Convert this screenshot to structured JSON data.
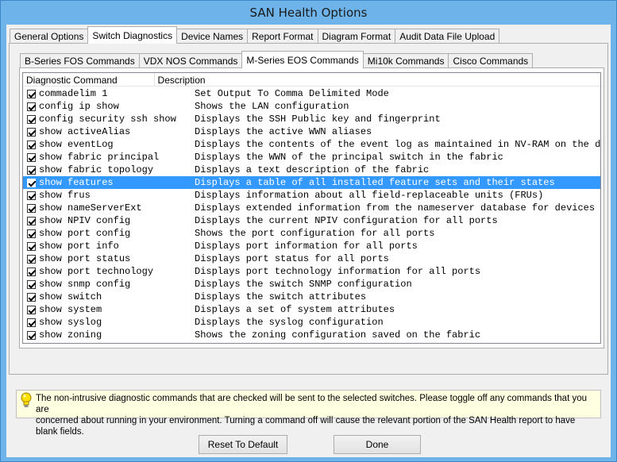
{
  "window": {
    "title": "SAN Health Options"
  },
  "main_tabs": [
    {
      "label": "General Options"
    },
    {
      "label": "Switch Diagnostics"
    },
    {
      "label": "Device Names"
    },
    {
      "label": "Report Format"
    },
    {
      "label": "Diagram Format"
    },
    {
      "label": "Audit Data File Upload"
    }
  ],
  "sub_tabs": [
    {
      "label": "B-Series FOS Commands"
    },
    {
      "label": "VDX NOS Commands"
    },
    {
      "label": "M-Series EOS Commands"
    },
    {
      "label": "Mi10k Commands"
    },
    {
      "label": "Cisco Commands"
    }
  ],
  "list": {
    "columns": [
      "Diagnostic Command",
      "Description"
    ],
    "rows": [
      {
        "command": "commadelim 1",
        "description": "Set Output To Comma Delimited Mode"
      },
      {
        "command": "config ip show",
        "description": "Shows the LAN configuration"
      },
      {
        "command": "config security ssh show",
        "description": "Displays the SSH Public key and fingerprint"
      },
      {
        "command": "show activeAlias",
        "description": "Displays the active WWN aliases"
      },
      {
        "command": "show eventLog",
        "description": "Displays the contents of the event log as maintained in NV-RAM on the di"
      },
      {
        "command": "show fabric principal",
        "description": "Displays the WWN of the principal switch in the fabric"
      },
      {
        "command": "show fabric topology",
        "description": "Displays a text description of the fabric"
      },
      {
        "command": "show features",
        "description": "Displays a table of all installed feature sets and their states"
      },
      {
        "command": "show frus",
        "description": "Displays information about all field-replaceable units (FRUs)"
      },
      {
        "command": "show nameServerExt",
        "description": "Displays extended information from the nameserver database for devices a"
      },
      {
        "command": "show NPIV config",
        "description": "Displays the current NPIV configuration for all ports"
      },
      {
        "command": "show port config",
        "description": "Shows the port configuration for all ports"
      },
      {
        "command": "show port info",
        "description": "Displays port information for all ports"
      },
      {
        "command": "show port status",
        "description": "Displays port status for all ports"
      },
      {
        "command": "show port technology",
        "description": "Displays port technology information for all ports"
      },
      {
        "command": "show snmp config",
        "description": "Displays the switch SNMP configuration"
      },
      {
        "command": "show switch",
        "description": "Displays the switch attributes"
      },
      {
        "command": "show system",
        "description": "Displays a set of system attributes"
      },
      {
        "command": "show syslog",
        "description": "Displays the syslog configuration"
      },
      {
        "command": "show zoning",
        "description": "Shows the zoning configuration saved on the fabric"
      }
    ]
  },
  "info": {
    "line1": "The non-intrusive diagnostic commands that are checked will be sent to the selected switches.  Please toggle off any commands that you are",
    "line2": "concerned about running in your environment.  Turning a command off will cause the relevant portion of the SAN Health report to have blank fields."
  },
  "buttons": {
    "reset": "Reset To Default",
    "done": "Done"
  },
  "colors": {
    "frame": "#6eb4ea",
    "selection": "#3399ff",
    "info_bg": "#ffffe1"
  }
}
